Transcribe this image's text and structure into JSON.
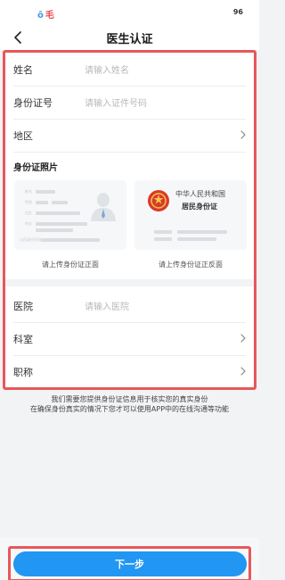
{
  "status_bar": {
    "left_mark_1": "ô",
    "left_mark_2": "毛",
    "battery": "96"
  },
  "nav": {
    "title": "医生认证"
  },
  "form": {
    "name": {
      "label": "姓名",
      "placeholder": "请输入姓名"
    },
    "id_number": {
      "label": "身份证号",
      "placeholder": "请输入证件号码"
    },
    "region": {
      "label": "地区"
    },
    "id_photos": {
      "section_title": "身份证照片",
      "front_caption": "请上传身份证正面",
      "back_caption": "请上传身份证正反面",
      "back_card_line1": "中华人民共和国",
      "back_card_line2": "居民身份证"
    },
    "hospital": {
      "label": "医院",
      "placeholder": "请输入医院"
    },
    "department": {
      "label": "科室"
    },
    "title": {
      "label": "职称"
    }
  },
  "info": {
    "line1": "我们需要您提供身份证信息用于核实您的真实身份",
    "line2": "在确保身份真实的情况下您才可以使用APP中的在线沟通等功能"
  },
  "footer": {
    "next_label": "下一步"
  },
  "colors": {
    "accent": "#2196f3",
    "highlight": "#e8575a",
    "emblem": "#d93a2b"
  }
}
